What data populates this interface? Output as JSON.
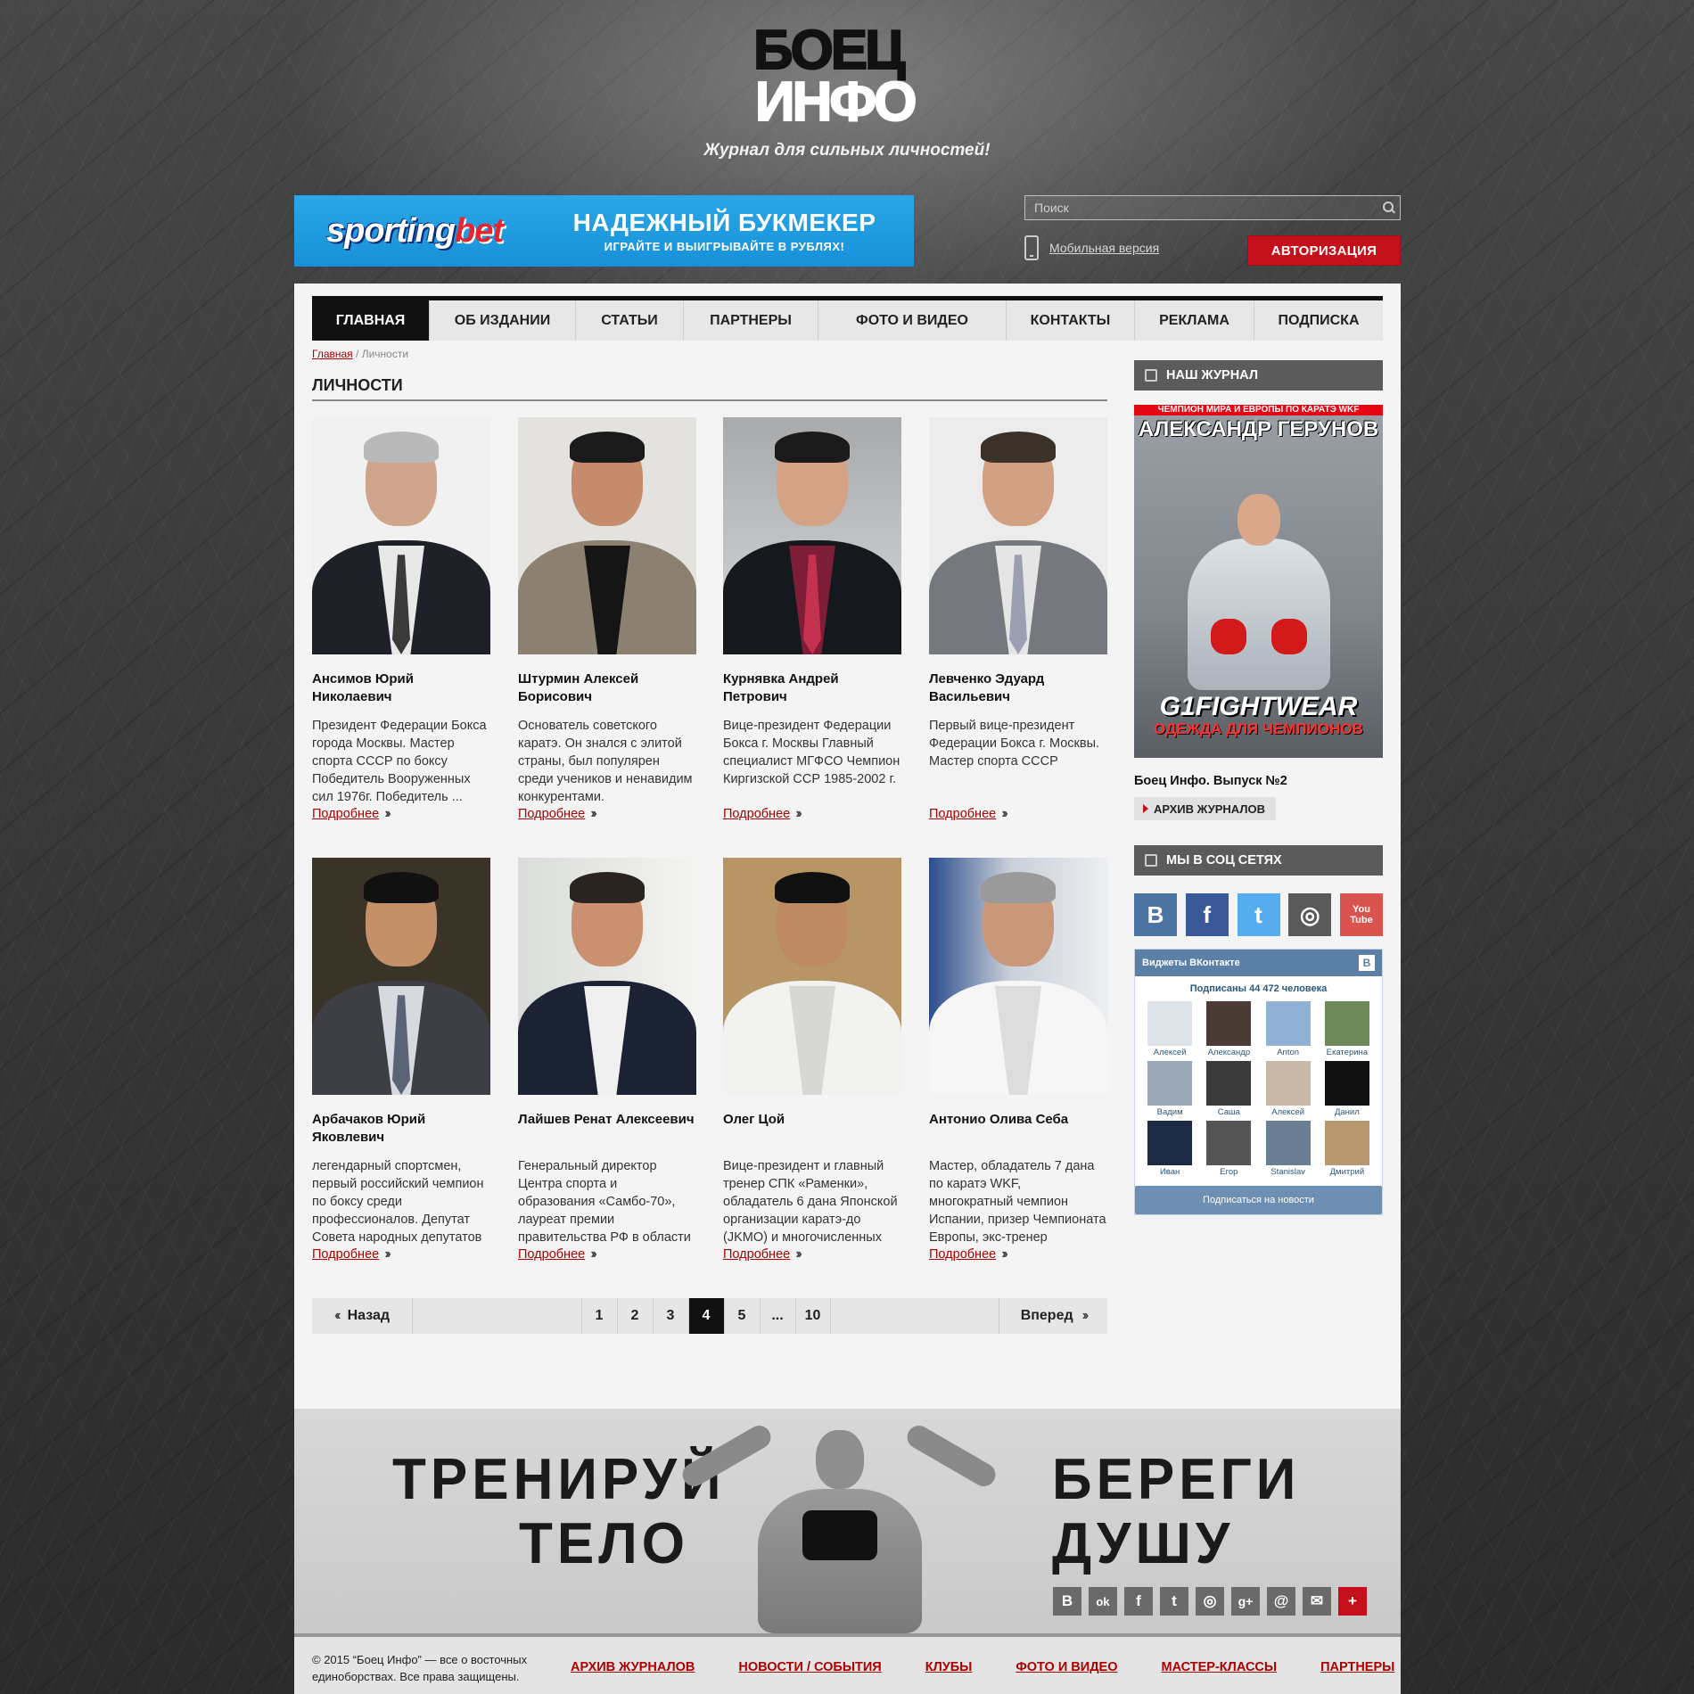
{
  "header": {
    "logo_line1": "БОЕЦ",
    "logo_line2": "ИНФО",
    "tagline": "Журнал для сильных личностей!"
  },
  "banner": {
    "brand_part1": "sporting",
    "brand_part2": "bet",
    "headline": "НАДЕЖНЫЙ БУКМЕКЕР",
    "subline": "ИГРАЙТЕ И ВЫИГРЫВАЙТЕ В РУБЛЯХ!"
  },
  "search": {
    "placeholder": "Поиск",
    "icon": "search-icon"
  },
  "mobile_link": "Мобильная версия",
  "auth_button": "АВТОРИЗАЦИЯ",
  "nav": [
    {
      "label": "ГЛАВНАЯ",
      "active": true
    },
    {
      "label": "ОБ ИЗДАНИИ",
      "active": false
    },
    {
      "label": "СТАТЬИ",
      "active": false
    },
    {
      "label": "ПАРТНЕРЫ",
      "active": false
    },
    {
      "label": "ФОТО И ВИДЕО",
      "active": false
    },
    {
      "label": "КОНТАКТЫ",
      "active": false
    },
    {
      "label": "РЕКЛАМА",
      "active": false
    },
    {
      "label": "ПОДПИСКА",
      "active": false
    }
  ],
  "breadcrumb": {
    "home": "Главная",
    "separator": "/",
    "current": "Личности"
  },
  "section_title": "ЛИЧНОСТИ",
  "more_label": "Подробнее",
  "people": [
    {
      "name": "Ансимов Юрий Николаевич",
      "desc": "Президент Федерации Бокса города Москвы. Мастер спорта СССР по боксу Победитель Вооруженных сил 1976г. Победитель ..."
    },
    {
      "name": "Штурмин Алексей Борисович",
      "desc": "Основатель советского каратэ. Он знался с элитой страны, был популярен среди учеников и ненавидим конкурентами."
    },
    {
      "name": "Курнявка Андрей Петрович",
      "desc": "Вице-президент Федерации Бокса г. Москвы Главный специалист МГФСО Чемпион Киргизской ССР 1985-2002 г."
    },
    {
      "name": "Левченко Эдуард Васильевич",
      "desc": "Первый вице-президент Федерации Бокса г. Москвы. Мастер спорта СССР"
    },
    {
      "name": "Арбачаков Юрий Яковлевич",
      "desc": "легендарный спортсмен, первый российский чемпион по боксу среди профессионалов. Депутат Совета народных депутатов"
    },
    {
      "name": "Лайшев Ренат Алексеевич",
      "desc": "Генеральный директор Центра спорта и образования «Самбо-70», лауреат премии правительства РФ в области образования, заслуженный..."
    },
    {
      "name": "Олег Цой",
      "desc": "Вице-президент и главный тренер СПК «Раменки», обладатель 6 дана Японской организации каратэ-до (JKMO) и многочисленных наград."
    },
    {
      "name": "Антонио Олива Себа",
      "desc": "Мастер, обладатель 7 дана по каратэ WKF, многократный чемпион Испании, призер Чемпионата Европы, экс-тренер испанской ..."
    }
  ],
  "pager": {
    "prev": "Назад",
    "next": "Вперед",
    "pages": [
      "1",
      "2",
      "3",
      "4",
      "5",
      "...",
      "10"
    ],
    "current": "4"
  },
  "sidebar": {
    "journal_title": "НАШ ЖУРНАЛ",
    "cover_top": "ЧЕМПИОН МИРА И ЕВРОПЫ ПО КАРАТЭ WKF",
    "cover_name": "АЛЕКСАНДР ГЕРУНОВ",
    "cover_brand": "G1FIGHTWEAR",
    "cover_sub": "ОДЕЖДА ДЛЯ ЧЕМПИОНОВ",
    "journal_caption": "Боец Инфо. Выпуск №2",
    "archive_button": "АРХИВ ЖУРНАЛОВ",
    "social_title": "МЫ В СОЦ СЕТЯХ",
    "social": [
      {
        "name": "vk-icon",
        "glyph": "B",
        "color": "#4c75a3"
      },
      {
        "name": "facebook-icon",
        "glyph": "f",
        "color": "#3b5998"
      },
      {
        "name": "twitter-icon",
        "glyph": "t",
        "color": "#55acee"
      },
      {
        "name": "instagram-icon",
        "glyph": "◎",
        "color": "#5a5a5a"
      },
      {
        "name": "youtube-icon",
        "glyph": "You Tube",
        "color": "#d9534f"
      }
    ]
  },
  "vk_widget": {
    "title": "Виджеты ВКонтакте",
    "count": "Подписаны 44 472 человека",
    "users": [
      "Алексей",
      "Александр",
      "Anton",
      "Екатерина",
      "Вадим",
      "Саша",
      "Алексей",
      "Данил",
      "Иван",
      "Егор",
      "Stanislav",
      "Дмитрий"
    ],
    "subscribe": "Подписаться на новости"
  },
  "promo": {
    "left1": "ТРЕНИРУЙ",
    "left2": "ТЕЛО",
    "right1": "БЕРЕГИ",
    "right2": "ДУШУ",
    "share": [
      {
        "name": "vk-share-icon",
        "glyph": "B"
      },
      {
        "name": "odnoklassniki-share-icon",
        "glyph": "ok"
      },
      {
        "name": "facebook-share-icon",
        "glyph": "f"
      },
      {
        "name": "twitter-share-icon",
        "glyph": "t"
      },
      {
        "name": "instagram-share-icon",
        "glyph": "◎"
      },
      {
        "name": "googleplus-share-icon",
        "glyph": "g+"
      },
      {
        "name": "mail-share-icon",
        "glyph": "@"
      },
      {
        "name": "email-share-icon",
        "glyph": "✉"
      },
      {
        "name": "more-share-icon",
        "glyph": "+"
      }
    ]
  },
  "footer": {
    "copyright": "© 2015 “Боец Инфо” — все о восточных единоборствах. Все права защищены.",
    "links": [
      "АРХИВ ЖУРНАЛОВ",
      "НОВОСТИ / СОБЫТИЯ",
      "КЛУБЫ",
      "ФОТО И ВИДЕО",
      "МАСТЕР-КЛАССЫ",
      "ПАРТНЕРЫ"
    ]
  }
}
